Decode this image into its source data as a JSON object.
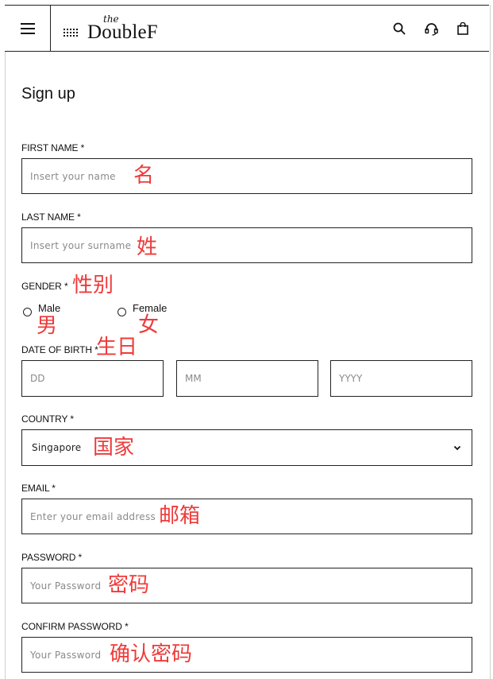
{
  "header": {
    "brand_small": "the",
    "brand_word": "DoubleF",
    "icons": [
      "menu-icon",
      "search-icon",
      "headset-icon",
      "bag-icon"
    ]
  },
  "page": {
    "title": "Sign up"
  },
  "form": {
    "first_name": {
      "label": "FIRST NAME *",
      "placeholder": "Insert your name"
    },
    "last_name": {
      "label": "LAST NAME *",
      "placeholder": "Insert your surname"
    },
    "gender": {
      "label": "GENDER *",
      "options": [
        "Male",
        "Female"
      ]
    },
    "dob": {
      "label": "DATE OF BIRTH *",
      "day": "DD",
      "month": "MM",
      "year": "YYYY"
    },
    "country": {
      "label": "COUNTRY *",
      "value": "Singapore"
    },
    "email": {
      "label": "EMAIL *",
      "placeholder": "Enter your email address"
    },
    "password": {
      "label": "PASSWORD *",
      "placeholder": "Your Password"
    },
    "confirm_password": {
      "label": "CONFIRM PASSWORD *",
      "placeholder": "Your Password"
    }
  },
  "annotations": {
    "first_name": "名",
    "last_name": "姓",
    "gender": "性别",
    "male": "男",
    "female": "女",
    "dob": "生日",
    "country": "国家",
    "email": "邮箱",
    "password": "密码",
    "confirm_password": "确认密码"
  },
  "colors": {
    "annotation": "#ef3a3a",
    "border": "#222222"
  }
}
